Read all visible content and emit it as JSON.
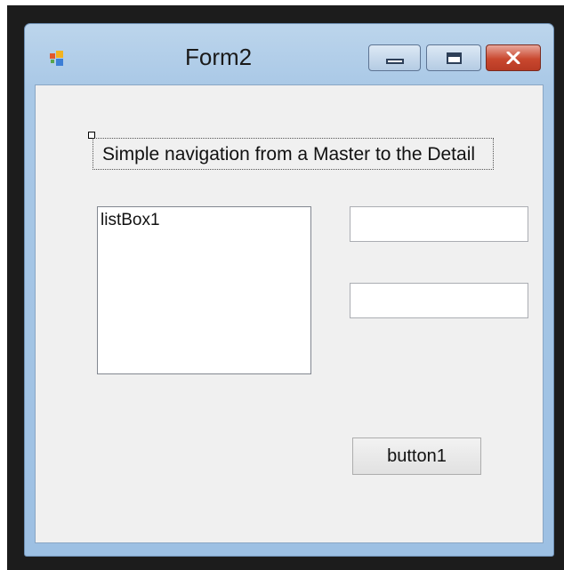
{
  "window": {
    "title": "Form2"
  },
  "form": {
    "label_text": "Simple navigation from a Master to the Detail",
    "listbox_text": "listBox1",
    "textbox1_value": "",
    "textbox2_value": "",
    "button_label": "button1"
  },
  "colors": {
    "frame": "#a9c8e6",
    "client": "#f0f0f0",
    "close_button": "#c9482f",
    "backdrop": "#1c1c1c"
  },
  "icons": {
    "app": "winforms-app-icon",
    "minimize": "minimize-icon",
    "maximize": "maximize-icon",
    "close": "close-icon"
  }
}
